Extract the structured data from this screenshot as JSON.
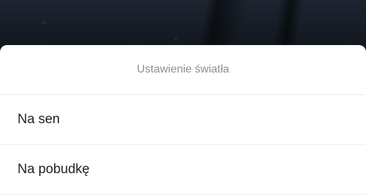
{
  "sheet": {
    "title": "Ustawienie światła",
    "options": [
      {
        "label": "Na sen"
      },
      {
        "label": "Na pobudkę"
      }
    ]
  },
  "colors": {
    "backdrop": "#151b24",
    "title_text": "#8e8e8e",
    "option_text": "#222222",
    "divider": "#ececec"
  }
}
